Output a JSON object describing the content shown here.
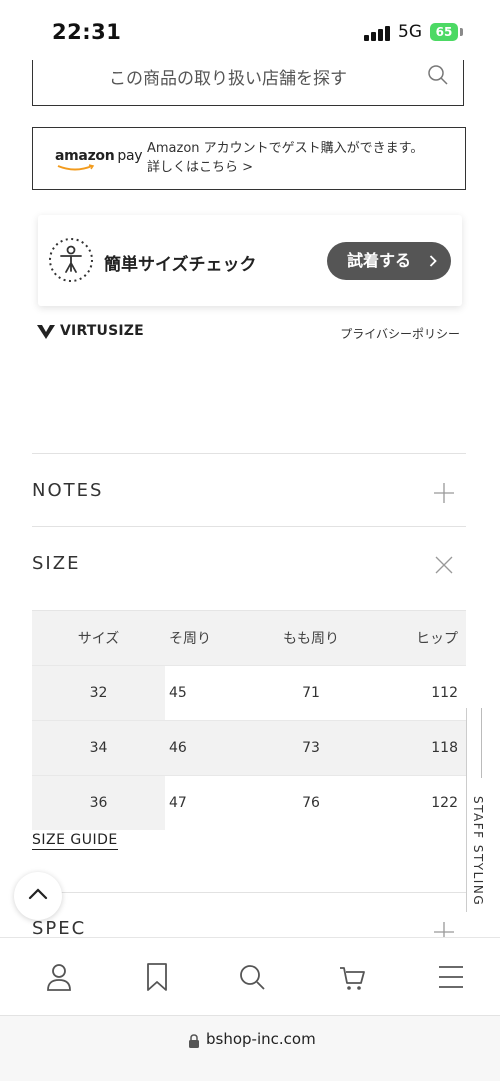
{
  "status_bar": {
    "time": "22:31",
    "network": "5G",
    "battery": "65"
  },
  "store_search": {
    "label": "この商品の取り扱い店舗を探す",
    "icon": "search-icon"
  },
  "amazon_pay": {
    "logo_amazon": "amazon",
    "logo_pay": "pay",
    "line1": "Amazon アカウントでゲスト購入ができます。",
    "line2": "詳しくはこちら >"
  },
  "size_check": {
    "title": "簡単サイズチェック",
    "button_label": "試着する"
  },
  "virtusize": {
    "brand": "VIRTUSIZE",
    "privacy": "プライバシーポリシー"
  },
  "sections": {
    "notes": "NOTES",
    "size": "SIZE",
    "spec": "SPEC"
  },
  "size_table": {
    "headers": [
      "サイズ",
      "そ周り",
      "もも周り",
      "ヒップ"
    ],
    "rows": [
      [
        "32",
        "45",
        "71",
        "112"
      ],
      [
        "34",
        "46",
        "73",
        "118"
      ],
      [
        "36",
        "47",
        "76",
        "122"
      ]
    ]
  },
  "size_guide": "SIZE GUIDE",
  "staff_styling": "STAFF STYLING",
  "bottom_nav": [
    "user-icon",
    "bookmark-icon",
    "search-icon",
    "cart-icon",
    "menu-icon"
  ],
  "url": "bshop-inc.com",
  "colors": {
    "button_dark": "#555555",
    "battery_green": "#4cd964",
    "table_shade": "#f2f2f2"
  }
}
